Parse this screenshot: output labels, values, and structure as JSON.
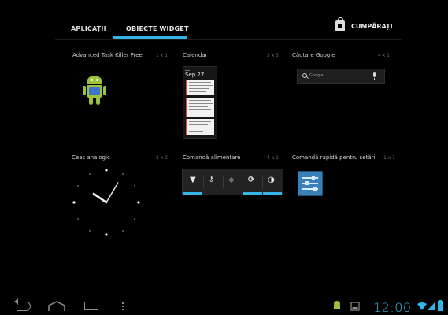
{
  "tabs": {
    "apps": "APLICAȚII",
    "widgets": "OBIECTE WIDGET",
    "shop": "CUMPĂRAȚI"
  },
  "widgets": [
    {
      "name": "Advanced Task Killer Free",
      "size": "1 x 1"
    },
    {
      "name": "Calendar",
      "size": "3 x 3"
    },
    {
      "name": "Căutare Google",
      "size": "4 x 1"
    },
    {
      "name": "Ceas analogic",
      "size": "2 x 2"
    },
    {
      "name": "Comandă alimentare",
      "size": "4 x 1"
    },
    {
      "name": "Comandă rapidă pentru setări",
      "size": "1 x 1"
    }
  ],
  "calendar_preview": {
    "date": "Sep 27"
  },
  "google_search": {
    "placeholder": "Google"
  },
  "status_bar": {
    "time": "12:00"
  },
  "colors": {
    "accent": "#33b5e5",
    "android_green": "#9bc23a"
  }
}
